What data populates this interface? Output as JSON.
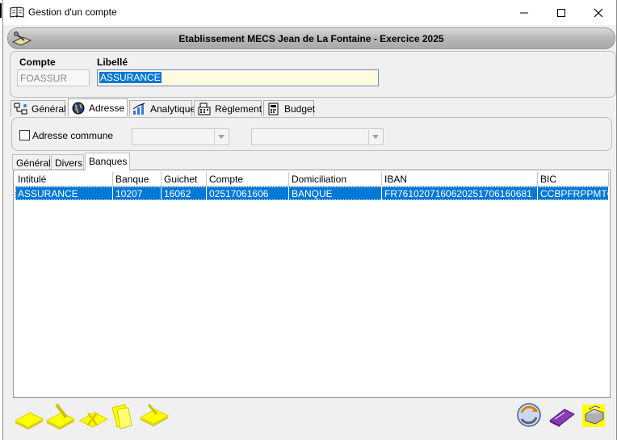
{
  "window": {
    "title": "Gestion d'un compte",
    "controls": {
      "minimize": "minimize-icon",
      "maximize": "maximize-icon",
      "close": "close-icon"
    }
  },
  "banner": {
    "title": "Etablissement MECS Jean de La Fontaine - Exercice 2025"
  },
  "account": {
    "compte_label": "Compte",
    "compte_value": "FOASSUR",
    "libelle_label": "Libellé",
    "libelle_value": "ASSURANCE"
  },
  "main_tabs": [
    {
      "label": "Général",
      "icon": "network-icon"
    },
    {
      "label": "Adresse",
      "icon": "globe-icon",
      "active": true
    },
    {
      "label": "Analytique",
      "icon": "chart-icon"
    },
    {
      "label": "Règlement",
      "icon": "cash-register-icon"
    },
    {
      "label": "Budget",
      "icon": "calculator-icon"
    }
  ],
  "address": {
    "commune_label": "Adresse commune",
    "commune_checked": false,
    "combo1_value": "",
    "combo2_value": ""
  },
  "sub_tabs": [
    {
      "label": "Général"
    },
    {
      "label": "Divers"
    },
    {
      "label": "Banques",
      "active": true
    }
  ],
  "bank_table": {
    "columns": [
      "Intitulé",
      "Banque",
      "Guichet",
      "Compte",
      "Domiciliation",
      "IBAN",
      "BIC"
    ],
    "rows": [
      [
        "ASSURANCE",
        "10207",
        "16062",
        "02517061606",
        "BANQUE",
        "FR7610207160620251706160681",
        "CCBPFRPPMTG"
      ]
    ]
  },
  "colors": {
    "selection": "#0078d7",
    "highlight": "#ffff00",
    "input_bg": "#fffbe0"
  },
  "footer_tools": {
    "left": [
      "new-record-icon",
      "edit-record-icon",
      "delete-record-icon",
      "copy-record-icon",
      "validate-record-icon"
    ],
    "right": [
      "refresh-icon",
      "book-icon",
      "print-icon"
    ]
  }
}
